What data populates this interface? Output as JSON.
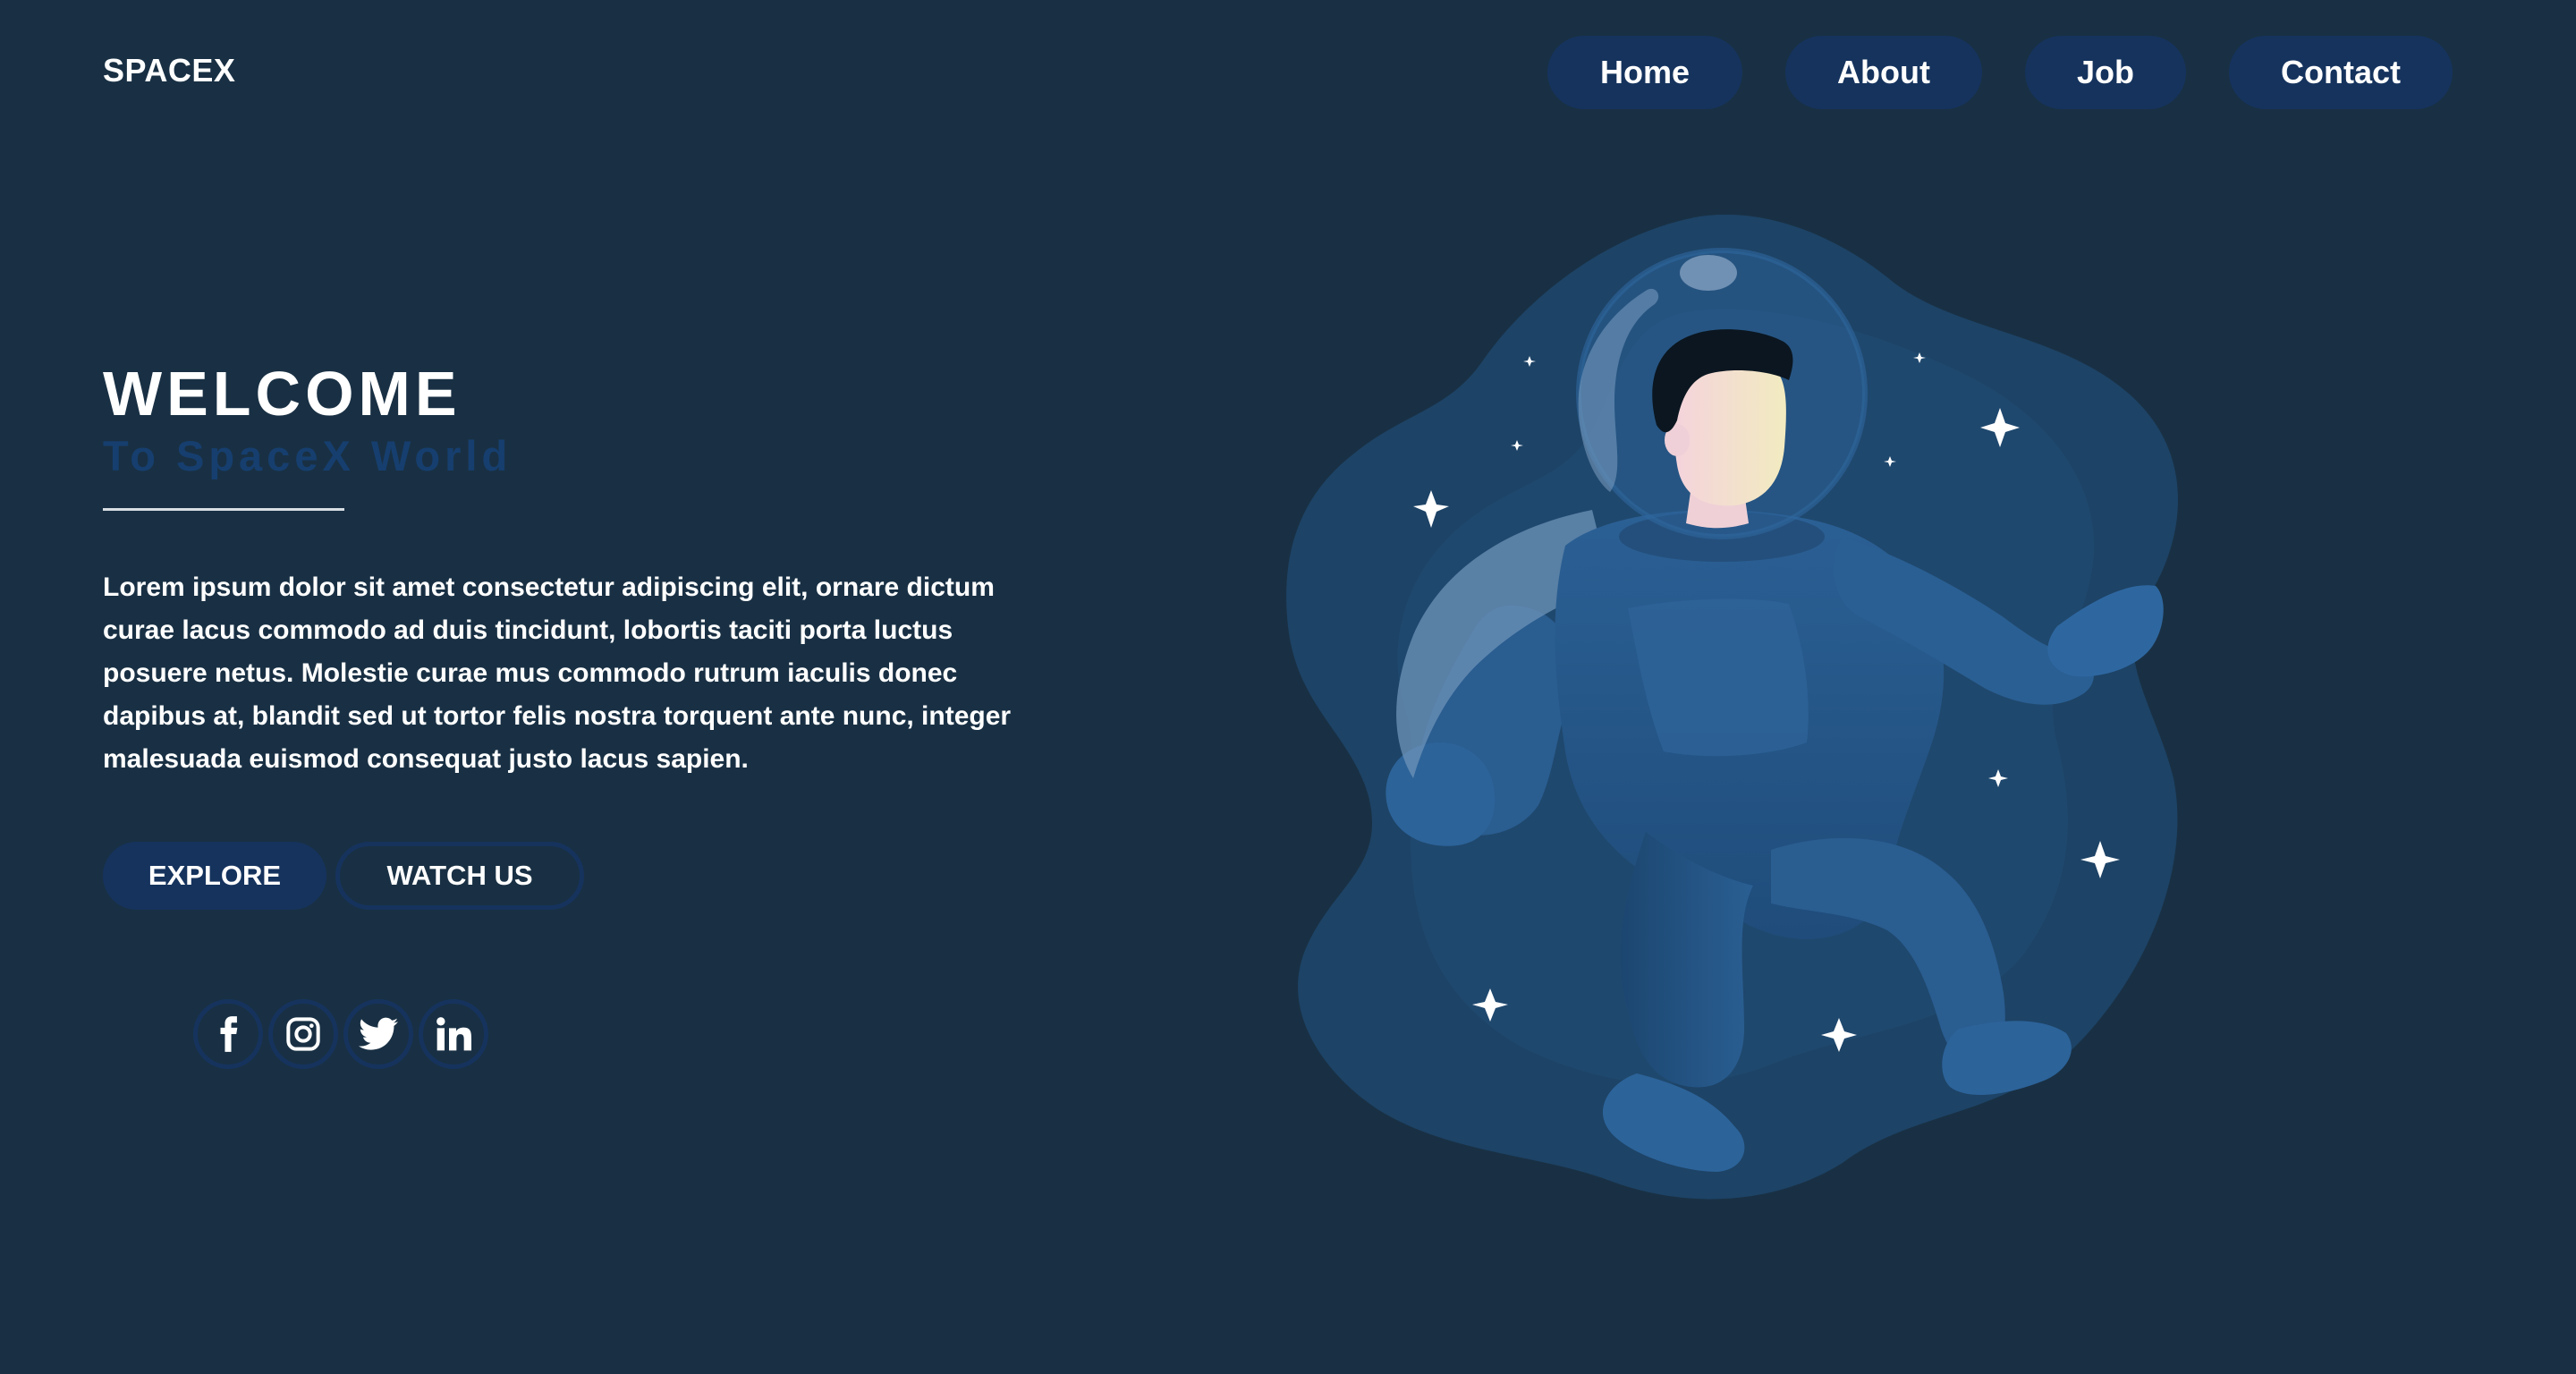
{
  "header": {
    "logo": "SPACEX",
    "nav": [
      "Home",
      "About",
      "Job",
      "Contact"
    ]
  },
  "hero": {
    "title": "WELCOME",
    "subtitle": "To SpaceX World",
    "body": "Lorem ipsum dolor sit amet consectetur adipiscing elit, ornare dictum curae lacus commodo ad duis tincidunt, lobortis taciti porta luctus posuere netus. Molestie curae mus commodo rutrum iaculis donec dapibus at, blandit sed ut tortor felis nostra torquent ante nunc, integer malesuada euismod consequat justo lacus sapien.",
    "buttons": {
      "explore": "EXPLORE",
      "watch": "WATCH US"
    }
  },
  "socials": [
    "facebook-icon",
    "instagram-icon",
    "twitter-icon",
    "linkedin-icon"
  ],
  "illustration": "astronaut floating in space",
  "colors": {
    "background": "#193044",
    "accent": "#15335d",
    "subtitle": "#163f6f",
    "text": "#ffffff"
  }
}
